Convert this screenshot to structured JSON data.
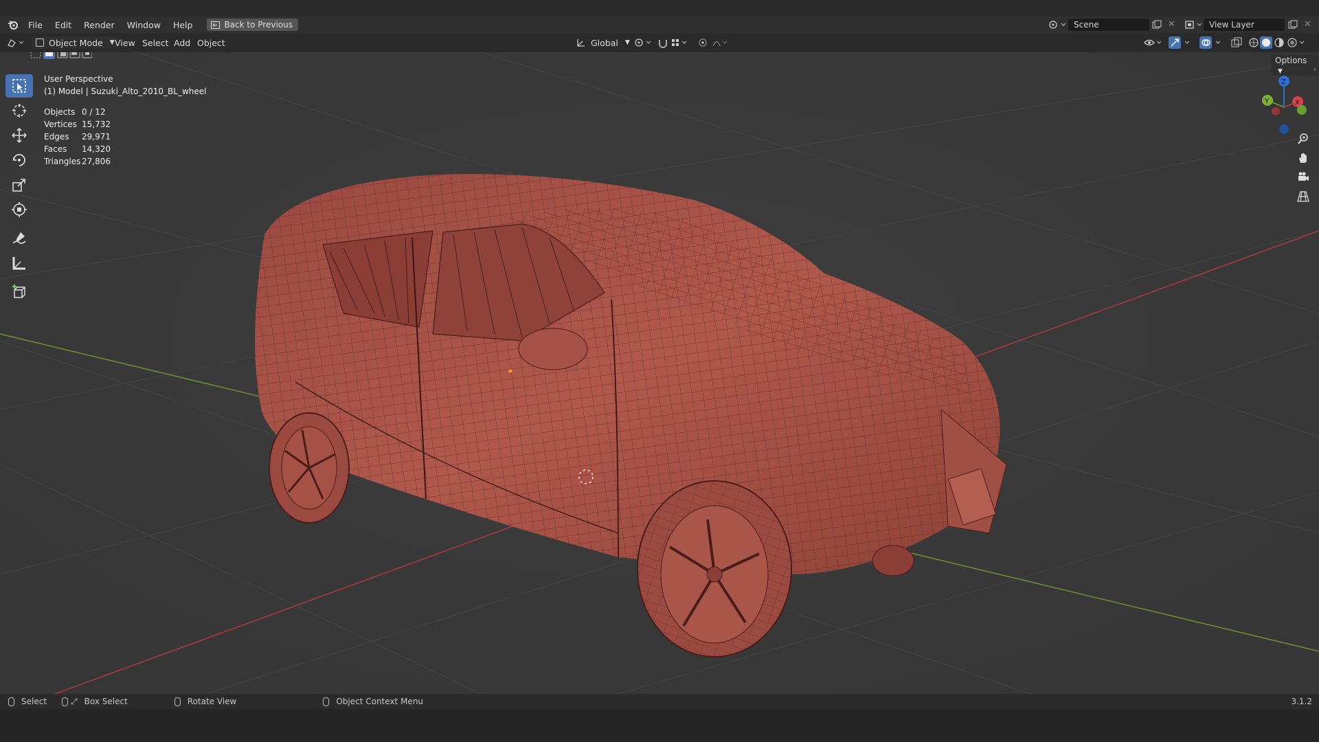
{
  "menu": {
    "items": [
      "File",
      "Edit",
      "Render",
      "Window",
      "Help"
    ],
    "back_button": "Back to Previous"
  },
  "top_right": {
    "scene_label": "Scene",
    "view_layer_label": "View Layer"
  },
  "header": {
    "mode": "Object Mode",
    "menus": [
      "View",
      "Select",
      "Add",
      "Object"
    ],
    "orientation": "Global",
    "options": "Options"
  },
  "overlay": {
    "perspective": "User Perspective",
    "object_info": "(1) Model | Suzuki_Alto_2010_BL_wheel",
    "stats": [
      {
        "label": "Objects",
        "value": "0 / 12"
      },
      {
        "label": "Vertices",
        "value": "15,732"
      },
      {
        "label": "Edges",
        "value": "29,971"
      },
      {
        "label": "Faces",
        "value": "14,320"
      },
      {
        "label": "Triangles",
        "value": "27,806"
      }
    ]
  },
  "gizmo": {
    "z": "Z",
    "y": "Y",
    "x": "X"
  },
  "status_bar": {
    "select": "Select",
    "box_select": "Box Select",
    "rotate_view": "Rotate View",
    "context_menu": "Object Context Menu",
    "version": "3.1.2"
  },
  "colors": {
    "active_tool": "#4772b3",
    "mesh": "#b4584c",
    "x_axis": "#a8393f",
    "y_axis": "#6b8f2f"
  }
}
